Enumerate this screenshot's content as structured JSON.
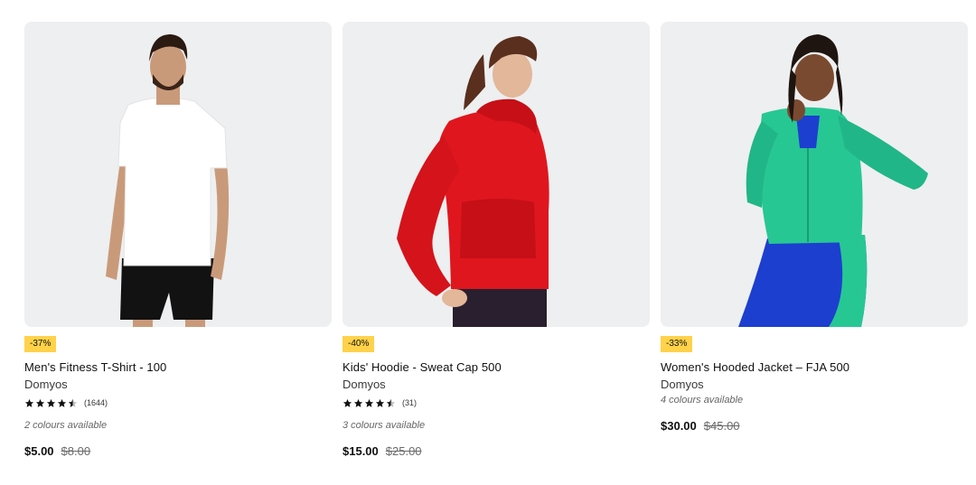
{
  "products": [
    {
      "discount": "-37%",
      "title": "Men's Fitness T-Shirt - 100",
      "brand": "Domyos",
      "rating": 4.5,
      "review_count": "(1644)",
      "colours": "2 colours available",
      "price": "$5.00",
      "old_price": "$8.00"
    },
    {
      "discount": "-40%",
      "title": "Kids' Hoodie - Sweat Cap 500",
      "brand": "Domyos",
      "rating": 4.5,
      "review_count": "(31)",
      "colours": "3 colours available",
      "price": "$15.00",
      "old_price": "$25.00"
    },
    {
      "discount": "-33%",
      "title": "Women's Hooded Jacket – FJA 500",
      "brand": "Domyos",
      "colours": "4 colours available",
      "price": "$30.00",
      "old_price": "$45.00"
    }
  ],
  "colors": {
    "badge": "#ffd24a",
    "image_bg": "#eeeff0",
    "tshirt": "#ffffff",
    "hoodie": "#e0161e",
    "jacket": "#27c794",
    "leggings": "#1c3fcf"
  },
  "icons": [
    "star-icon",
    "half-star-icon"
  ]
}
